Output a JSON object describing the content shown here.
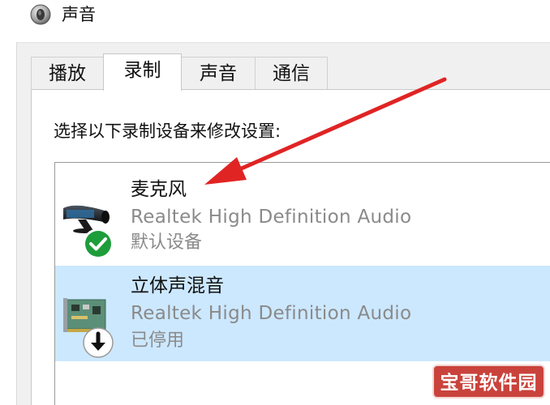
{
  "window": {
    "title": "声音",
    "icon": "speaker-icon"
  },
  "tabs": [
    {
      "label": "播放",
      "active": false
    },
    {
      "label": "录制",
      "active": true
    },
    {
      "label": "声音",
      "active": false
    },
    {
      "label": "通信",
      "active": false
    }
  ],
  "instruction": "选择以下录制设备来修改设置:",
  "devices": [
    {
      "name": "麦克风",
      "driver": "Realtek High Definition Audio",
      "status": "默认设备",
      "icon": "microphone-icon",
      "status_icon": "checkmark-icon",
      "selected": false
    },
    {
      "name": "立体声混音",
      "driver": "Realtek High Definition Audio",
      "status": "已停用",
      "icon": "sound-card-icon",
      "status_icon": "disabled-arrow-icon",
      "selected": true
    }
  ],
  "annotation": {
    "color": "#e02424",
    "icon": "red-arrow-annotation"
  },
  "watermark": {
    "text": "宝哥软件园"
  },
  "colors": {
    "selected_row": "#cce8ff",
    "secondary_text": "#8a8a8a",
    "check_green": "#1e9d3b"
  }
}
